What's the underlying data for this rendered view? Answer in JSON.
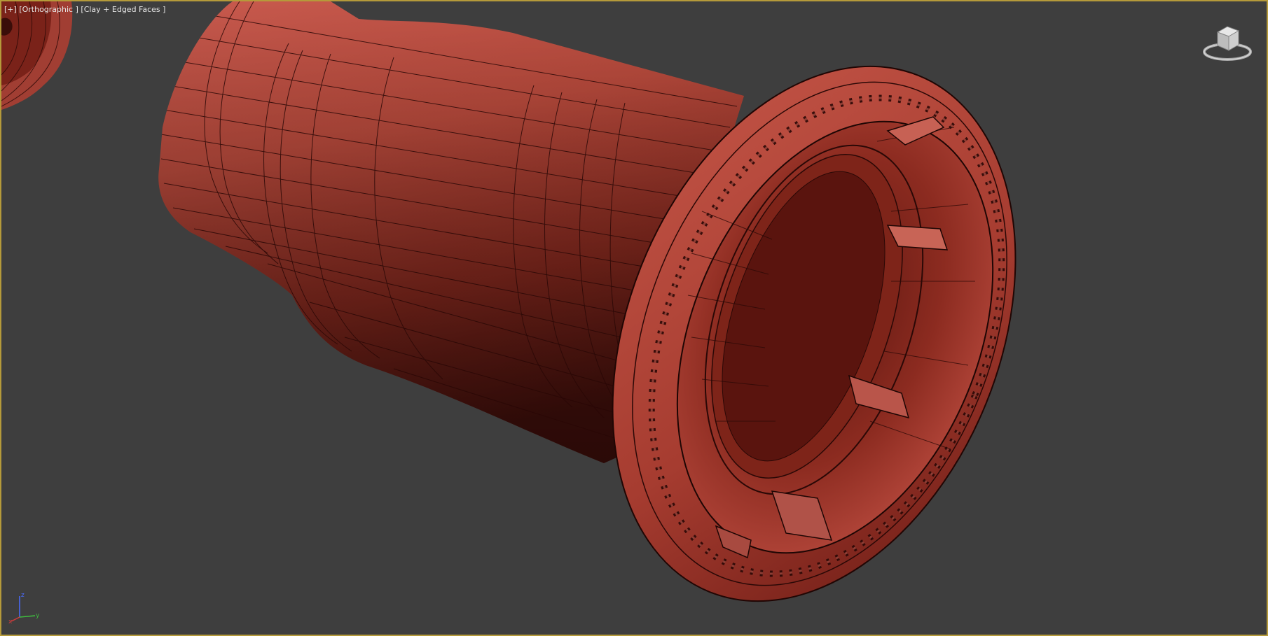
{
  "viewport": {
    "menu_label": "[+]",
    "view_label": "[Orthographic ]",
    "shading_label": "[Clay + Edged Faces ]"
  },
  "viewcube": {
    "icon": "viewcube-icon"
  },
  "axis_tripod": {
    "x": "x",
    "y": "y",
    "z": "z"
  },
  "colors": {
    "background": "#3e3e3e",
    "active_border": "#b59a3a",
    "clay": "#b8473a",
    "clay_dark": "#5a130f",
    "wire": "#1e0604"
  }
}
